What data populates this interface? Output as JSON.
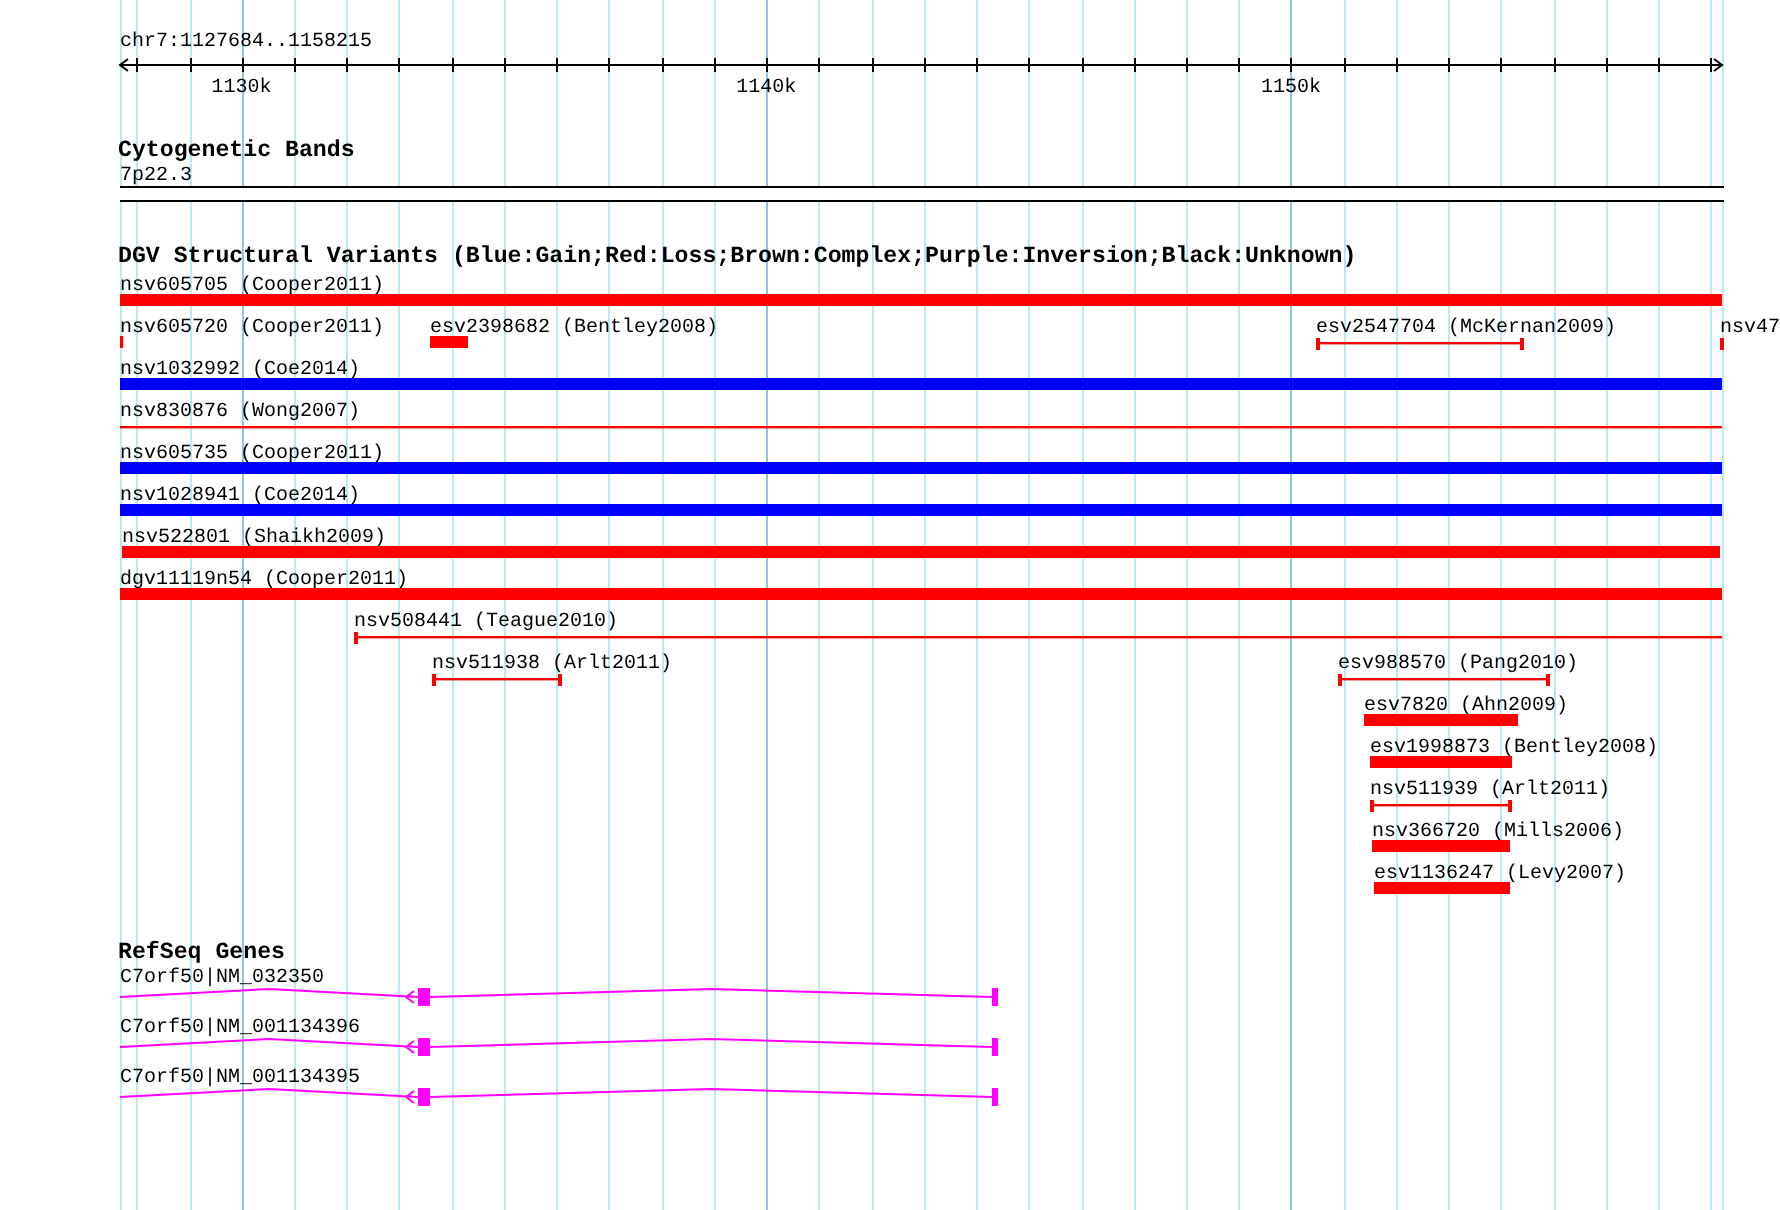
{
  "ruler": {
    "region": "chr7:1127684..1158215",
    "ticks": [
      {
        "label": "1130k"
      },
      {
        "label": "1140k"
      },
      {
        "label": "1150k"
      }
    ]
  },
  "cytogenetic_bands": {
    "title": "Cytogenetic Bands",
    "band": "7p22.3"
  },
  "dgv": {
    "title": "DGV Structural Variants (Blue:Gain;Red:Loss;Brown:Complex;Purple:Inversion;Black:Unknown)",
    "rows": [
      {
        "features": [
          {
            "label": "nsv605705 (Cooper2011)",
            "kind": "block",
            "color": "#ff0000"
          }
        ]
      },
      {
        "features": [
          {
            "label": "nsv605720 (Cooper2011)",
            "kind": "block",
            "color": "#ff0000"
          },
          {
            "label": "esv2398682 (Bentley2008)",
            "kind": "block",
            "color": "#ff0000"
          },
          {
            "label": "esv2547704 (McKernan2009)",
            "kind": "span",
            "color": "#ff0000"
          },
          {
            "label": "nsv47",
            "kind": "span",
            "color": "#ff0000"
          }
        ]
      },
      {
        "features": [
          {
            "label": "nsv1032992 (Coe2014)",
            "kind": "block",
            "color": "#0000ff"
          }
        ]
      },
      {
        "features": [
          {
            "label": "nsv830876 (Wong2007)",
            "kind": "span",
            "color": "#ff0000"
          }
        ]
      },
      {
        "features": [
          {
            "label": "nsv605735 (Cooper2011)",
            "kind": "block",
            "color": "#0000ff"
          }
        ]
      },
      {
        "features": [
          {
            "label": "nsv1028941 (Coe2014)",
            "kind": "block",
            "color": "#0000ff"
          }
        ]
      },
      {
        "features": [
          {
            "label": "nsv522801 (Shaikh2009)",
            "kind": "block",
            "color": "#ff0000"
          }
        ]
      },
      {
        "features": [
          {
            "label": "dgv11119n54 (Cooper2011)",
            "kind": "block",
            "color": "#ff0000"
          }
        ]
      },
      {
        "features": [
          {
            "label": "nsv508441 (Teague2010)",
            "kind": "span",
            "color": "#ff0000"
          }
        ]
      },
      {
        "features": [
          {
            "label": "nsv511938 (Arlt2011)",
            "kind": "span",
            "color": "#ff0000"
          },
          {
            "label": "esv988570 (Pang2010)",
            "kind": "span",
            "color": "#ff0000"
          }
        ]
      },
      {
        "features": [
          {
            "label": "esv7820 (Ahn2009)",
            "kind": "block",
            "color": "#ff0000"
          }
        ]
      },
      {
        "features": [
          {
            "label": "esv1998873 (Bentley2008)",
            "kind": "block",
            "color": "#ff0000"
          }
        ]
      },
      {
        "features": [
          {
            "label": "nsv511939 (Arlt2011)",
            "kind": "span",
            "color": "#ff0000"
          }
        ]
      },
      {
        "features": [
          {
            "label": "nsv366720 (Mills2006)",
            "kind": "block",
            "color": "#ff0000"
          }
        ]
      },
      {
        "features": [
          {
            "label": "esv1136247 (Levy2007)",
            "kind": "block",
            "color": "#ff0000"
          }
        ]
      }
    ]
  },
  "refseq": {
    "title": "RefSeq Genes",
    "transcripts": [
      {
        "label": "C7orf50|NM_032350",
        "reverse_strand": true
      },
      {
        "label": "C7orf50|NM_001134396",
        "reverse_strand": true
      },
      {
        "label": "C7orf50|NM_001134395",
        "reverse_strand": true
      }
    ]
  }
}
